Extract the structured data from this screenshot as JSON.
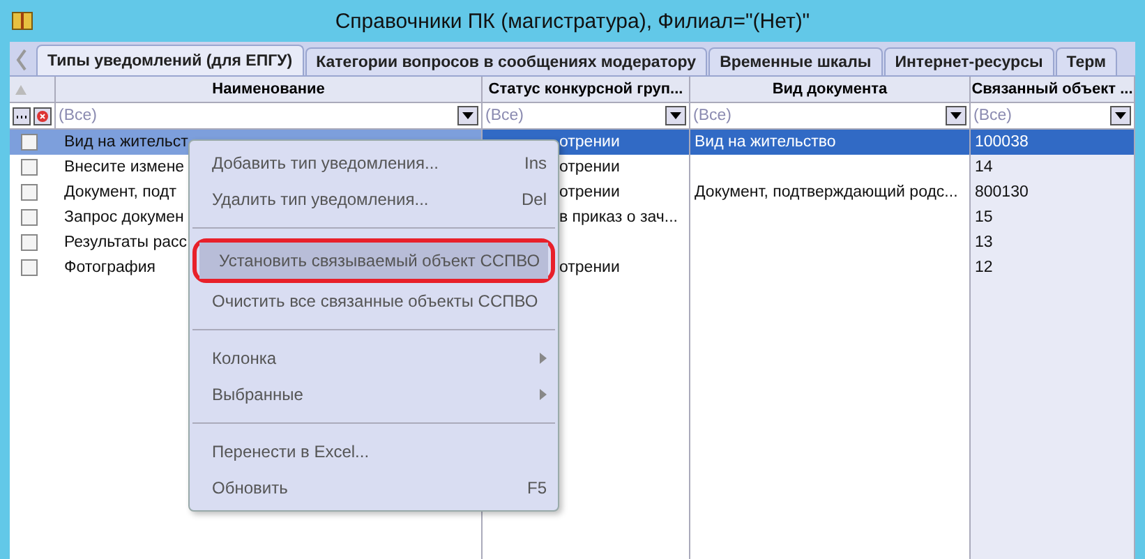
{
  "window": {
    "title": "Справочники ПК (магистратура), Филиал=\"(Нет)\""
  },
  "tabs": [
    {
      "label": "Типы уведомлений (для ЕПГУ)",
      "selected": true
    },
    {
      "label": "Категории вопросов в сообщениях модератору",
      "selected": false
    },
    {
      "label": "Временные шкалы",
      "selected": false
    },
    {
      "label": "Интернет-ресурсы",
      "selected": false
    },
    {
      "label": "Терм",
      "selected": false
    }
  ],
  "table": {
    "columns": [
      "Наименование",
      "Статус конкурсной груп...",
      "Вид документа",
      "Связанный объект ..."
    ],
    "filters": [
      "(Все)",
      "(Все)",
      "(Все)",
      "(Все)"
    ],
    "rows": [
      {
        "checked": false,
        "selected": true,
        "cells": [
          "Вид на жительст",
          "отрении",
          "Вид на жительство",
          "100038"
        ]
      },
      {
        "checked": false,
        "selected": false,
        "cells": [
          "Внесите измене",
          "отрении",
          "",
          "14"
        ]
      },
      {
        "checked": false,
        "selected": false,
        "cells": [
          "Документ, подт",
          "отрении",
          "Документ, подтверждающий родс...",
          "800130"
        ]
      },
      {
        "checked": false,
        "selected": false,
        "cells": [
          "Запрос докумен",
          "в приказ о зач...",
          "",
          "15"
        ]
      },
      {
        "checked": false,
        "selected": false,
        "cells": [
          "Результаты расс",
          "",
          "",
          "13"
        ]
      },
      {
        "checked": false,
        "selected": false,
        "cells": [
          "Фотография",
          "отрении",
          "",
          "12"
        ]
      }
    ]
  },
  "context_menu": [
    {
      "kind": "item",
      "label": "Добавить тип уведомления...",
      "shortcut": "Ins",
      "highlighted": false
    },
    {
      "kind": "item",
      "label": "Удалить тип уведомления...",
      "shortcut": "Del",
      "highlighted": false
    },
    {
      "kind": "separator"
    },
    {
      "kind": "item",
      "label": "Установить связываемый объект ССПВО",
      "highlighted": true
    },
    {
      "kind": "item",
      "label": "Очистить все связанные объекты ССПВО",
      "highlighted": false
    },
    {
      "kind": "separator"
    },
    {
      "kind": "submenu",
      "label": "Колонка",
      "highlighted": false
    },
    {
      "kind": "submenu",
      "label": "Выбранные",
      "highlighted": false
    },
    {
      "kind": "separator"
    },
    {
      "kind": "item",
      "label": "Перенести в Excel...",
      "highlighted": false
    },
    {
      "kind": "item",
      "label": "Обновить",
      "shortcut": "F5",
      "highlighted": false
    }
  ]
}
